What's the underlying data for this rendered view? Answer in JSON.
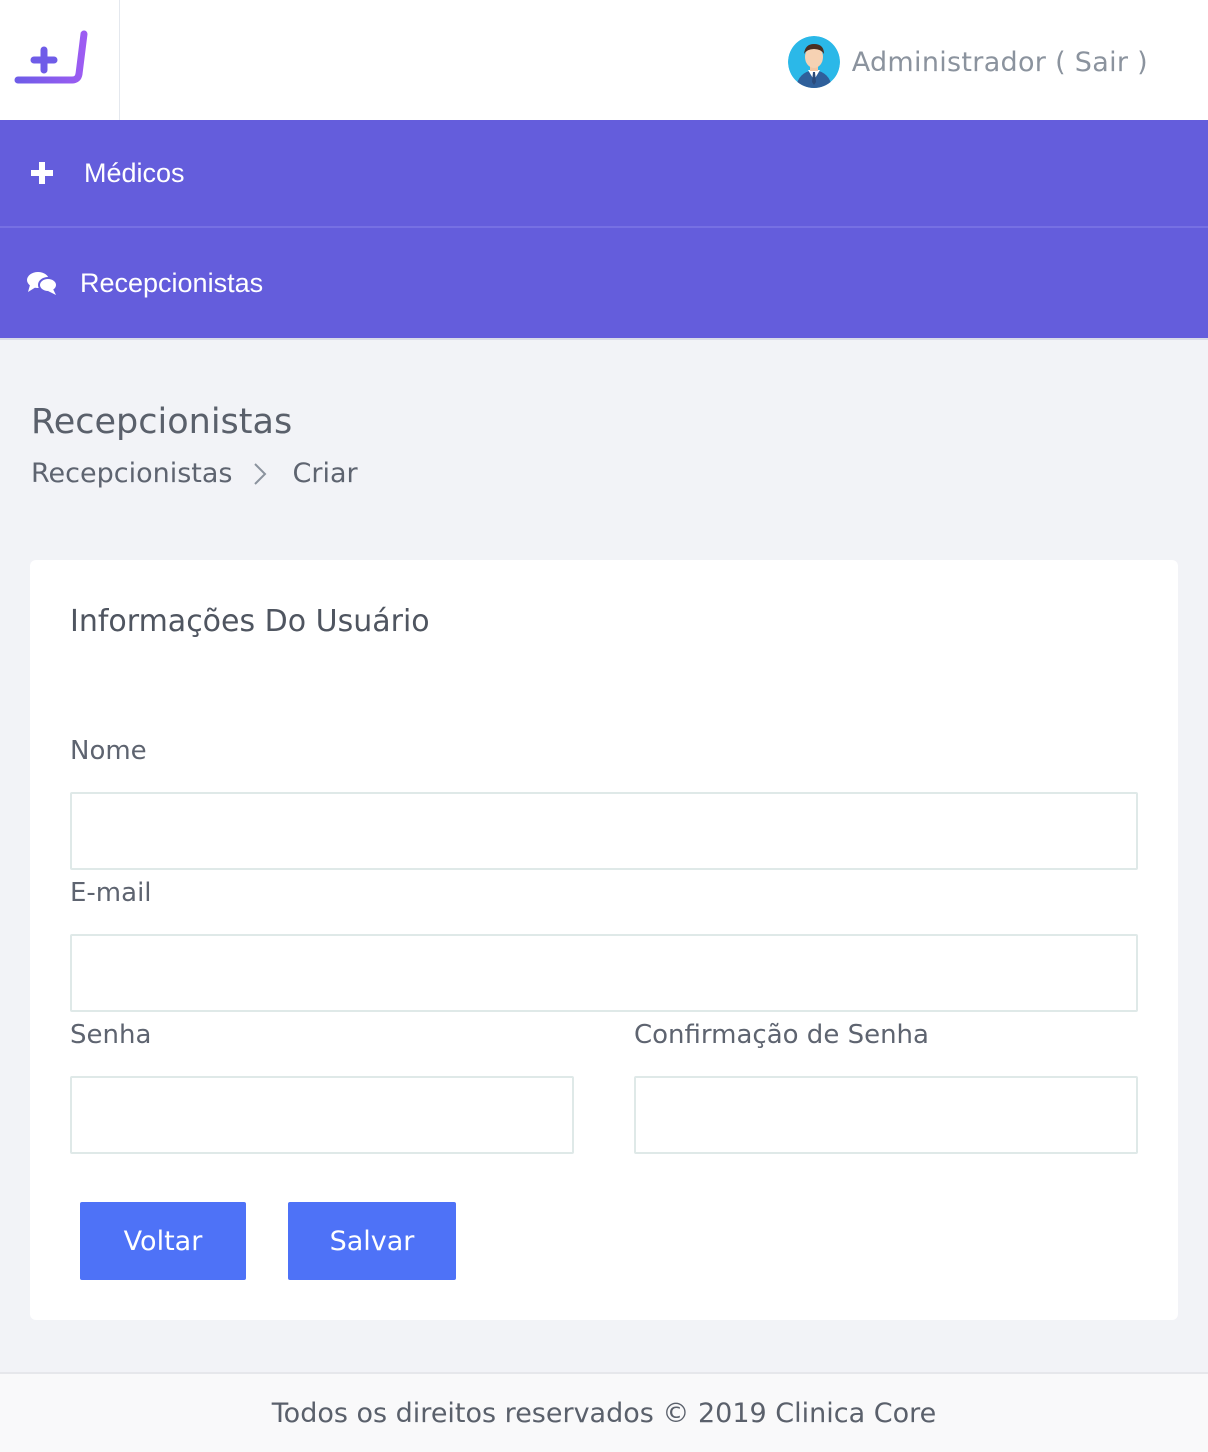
{
  "header": {
    "logo_icon": "plus-j-logo",
    "user": {
      "avatar_icon": "businessman-avatar",
      "label": "Administrador ( Sair )"
    }
  },
  "nav": {
    "items": [
      {
        "icon": "plus-icon",
        "label": "Médicos"
      },
      {
        "icon": "chat-bubbles-icon",
        "label": "Recepcionistas"
      }
    ],
    "color": "#645ddc"
  },
  "page": {
    "title": "Recepcionistas",
    "breadcrumb": [
      "Recepcionistas",
      "Criar"
    ]
  },
  "form": {
    "title": "Informações Do Usuário",
    "fields": {
      "nome": {
        "label": "Nome",
        "value": "",
        "placeholder": ""
      },
      "email": {
        "label": "E-mail",
        "value": "",
        "placeholder": ""
      },
      "senha": {
        "label": "Senha",
        "value": "",
        "placeholder": ""
      },
      "confirmacao": {
        "label": "Confirmação de Senha",
        "value": "",
        "placeholder": ""
      }
    },
    "buttons": {
      "back": "Voltar",
      "save": "Salvar"
    },
    "button_color": "#4e72f7"
  },
  "footer": {
    "text": "Todos os direitos reservados © 2019 Clinica Core"
  }
}
